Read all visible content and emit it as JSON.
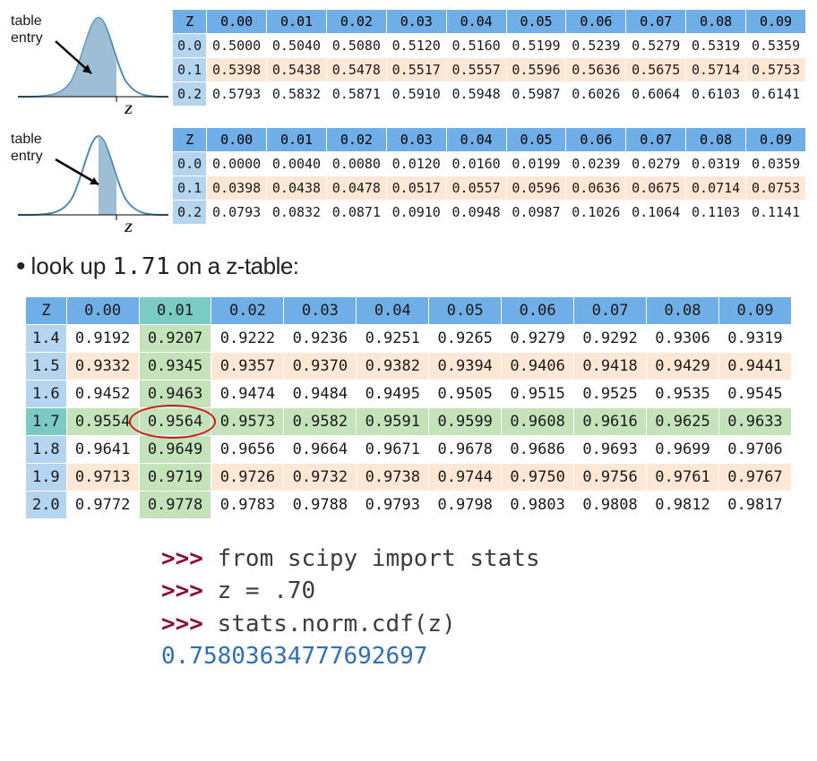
{
  "diagram_label": "table\nentry",
  "z_letter": "Z",
  "columns": [
    "0.00",
    "0.01",
    "0.02",
    "0.03",
    "0.04",
    "0.05",
    "0.06",
    "0.07",
    "0.08",
    "0.09"
  ],
  "z_header": "Z",
  "table1": {
    "rows": [
      {
        "z": "0.0",
        "v": [
          "0.5000",
          "0.5040",
          "0.5080",
          "0.5120",
          "0.5160",
          "0.5199",
          "0.5239",
          "0.5279",
          "0.5319",
          "0.5359"
        ]
      },
      {
        "z": "0.1",
        "v": [
          "0.5398",
          "0.5438",
          "0.5478",
          "0.5517",
          "0.5557",
          "0.5596",
          "0.5636",
          "0.5675",
          "0.5714",
          "0.5753"
        ]
      },
      {
        "z": "0.2",
        "v": [
          "0.5793",
          "0.5832",
          "0.5871",
          "0.5910",
          "0.5948",
          "0.5987",
          "0.6026",
          "0.6064",
          "0.6103",
          "0.6141"
        ]
      }
    ]
  },
  "table2": {
    "rows": [
      {
        "z": "0.0",
        "v": [
          "0.0000",
          "0.0040",
          "0.0080",
          "0.0120",
          "0.0160",
          "0.0199",
          "0.0239",
          "0.0279",
          "0.0319",
          "0.0359"
        ]
      },
      {
        "z": "0.1",
        "v": [
          "0.0398",
          "0.0438",
          "0.0478",
          "0.0517",
          "0.0557",
          "0.0596",
          "0.0636",
          "0.0675",
          "0.0714",
          "0.0753"
        ]
      },
      {
        "z": "0.2",
        "v": [
          "0.0793",
          "0.0832",
          "0.0871",
          "0.0910",
          "0.0948",
          "0.0987",
          "0.1026",
          "0.1064",
          "0.1103",
          "0.1141"
        ]
      }
    ]
  },
  "lookup_text_before": "look up ",
  "lookup_value": "1.71",
  "lookup_text_after": " on a z-table:",
  "main_table": {
    "highlight_col": 1,
    "rows": [
      {
        "z": "1.4",
        "v": [
          "0.9192",
          "0.9207",
          "0.9222",
          "0.9236",
          "0.9251",
          "0.9265",
          "0.9279",
          "0.9292",
          "0.9306",
          "0.9319"
        ]
      },
      {
        "z": "1.5",
        "v": [
          "0.9332",
          "0.9345",
          "0.9357",
          "0.9370",
          "0.9382",
          "0.9394",
          "0.9406",
          "0.9418",
          "0.9429",
          "0.9441"
        ]
      },
      {
        "z": "1.6",
        "v": [
          "0.9452",
          "0.9463",
          "0.9474",
          "0.9484",
          "0.9495",
          "0.9505",
          "0.9515",
          "0.9525",
          "0.9535",
          "0.9545"
        ]
      },
      {
        "z": "1.7",
        "v": [
          "0.9554",
          "0.9564",
          "0.9573",
          "0.9582",
          "0.9591",
          "0.9599",
          "0.9608",
          "0.9616",
          "0.9625",
          "0.9633"
        ]
      },
      {
        "z": "1.8",
        "v": [
          "0.9641",
          "0.9649",
          "0.9656",
          "0.9664",
          "0.9671",
          "0.9678",
          "0.9686",
          "0.9693",
          "0.9699",
          "0.9706"
        ]
      },
      {
        "z": "1.9",
        "v": [
          "0.9713",
          "0.9719",
          "0.9726",
          "0.9732",
          "0.9738",
          "0.9744",
          "0.9750",
          "0.9756",
          "0.9761",
          "0.9767"
        ]
      },
      {
        "z": "2.0",
        "v": [
          "0.9772",
          "0.9778",
          "0.9783",
          "0.9788",
          "0.9793",
          "0.9798",
          "0.9803",
          "0.9808",
          "0.9812",
          "0.9817"
        ]
      }
    ],
    "highlight_row": 3,
    "circle_cell": {
      "row": 3,
      "col": 1
    }
  },
  "repl": {
    "prompt": ">>>",
    "lines": [
      "from scipy import stats",
      "z = .70",
      "stats.norm.cdf(z)"
    ],
    "result": "0.75803634777692697"
  }
}
